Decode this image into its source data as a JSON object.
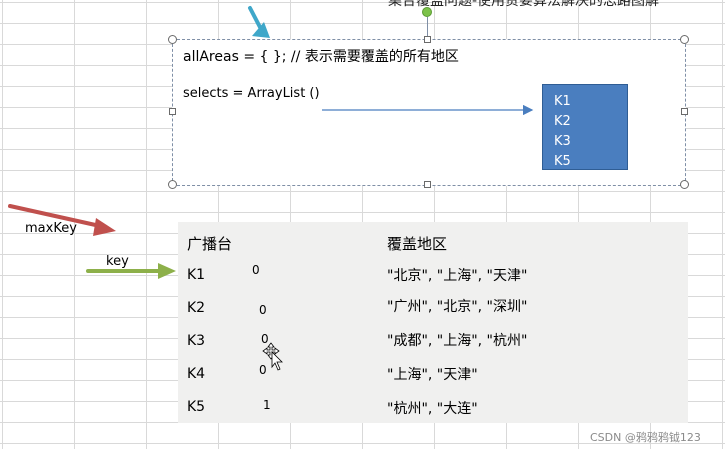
{
  "slide": {
    "title_fragment": "集合覆盖问题-使用贪婪算法解决的思路图解",
    "code_line1": "allAreas = { }; // 表示需要覆盖的所有地区",
    "code_line2": "selects  = ArrayList ()"
  },
  "selects_box": {
    "items": [
      "K1",
      "K2",
      "K3",
      "K5"
    ]
  },
  "labels": {
    "maxKey": "maxKey",
    "key": "key"
  },
  "table": {
    "header": {
      "station": "广播台",
      "areas": "覆盖地区"
    },
    "rows": [
      {
        "key": "K1",
        "count": "0",
        "areas": "\"北京\", \"上海\", \"天津\""
      },
      {
        "key": "K2",
        "count": "0",
        "areas": "\"广州\", \"北京\", \"深圳\""
      },
      {
        "key": "K3",
        "count": "0",
        "areas": "\"成都\", \"上海\", \"杭州\""
      },
      {
        "key": "K4",
        "count": "0",
        "areas": "\"上海\", \"天津\""
      },
      {
        "key": "K5",
        "count": "1",
        "areas": "\"杭州\", \"大连\""
      }
    ]
  },
  "watermark": "CSDN @鸦鸦鸦钺123",
  "colors": {
    "blue_box": "#4a7ebf",
    "red_arrow": "#c0504d",
    "green_arrow": "#8db04a",
    "cyan_arrow": "#3fa7c9",
    "connector": "#4a7ebf"
  }
}
